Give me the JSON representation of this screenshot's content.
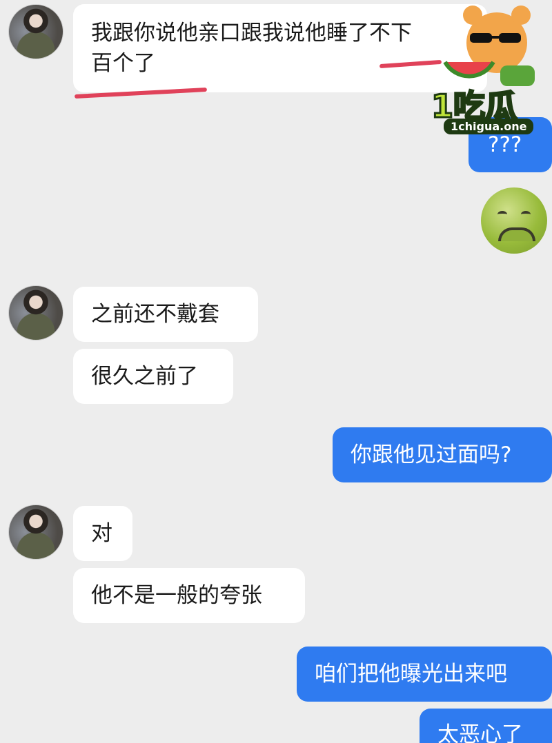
{
  "messages": [
    {
      "side": "in",
      "text_line1": "我跟你说他亲口跟我说他睡了不下",
      "text_line2": "百个了"
    },
    {
      "side": "out",
      "text": "???"
    },
    {
      "side": "out",
      "text": "🤢"
    },
    {
      "side": "in",
      "text": "之前还不戴套"
    },
    {
      "side": "in",
      "text": "很久之前了"
    },
    {
      "side": "out",
      "text": "你跟他见过面吗?"
    },
    {
      "side": "in",
      "text": "对"
    },
    {
      "side": "in",
      "text": "他不是一般的夸张"
    },
    {
      "side": "out",
      "text": "咱们把他曝光出来吧"
    },
    {
      "side": "out",
      "text": "太恶心了"
    }
  ],
  "watermark": {
    "brand": "1吃瓜",
    "site": "1chigua.one"
  },
  "colors": {
    "outgoing": "#2f7bf0",
    "incoming": "#ffffff",
    "background": "#ededed",
    "underline": "#e0425a"
  }
}
